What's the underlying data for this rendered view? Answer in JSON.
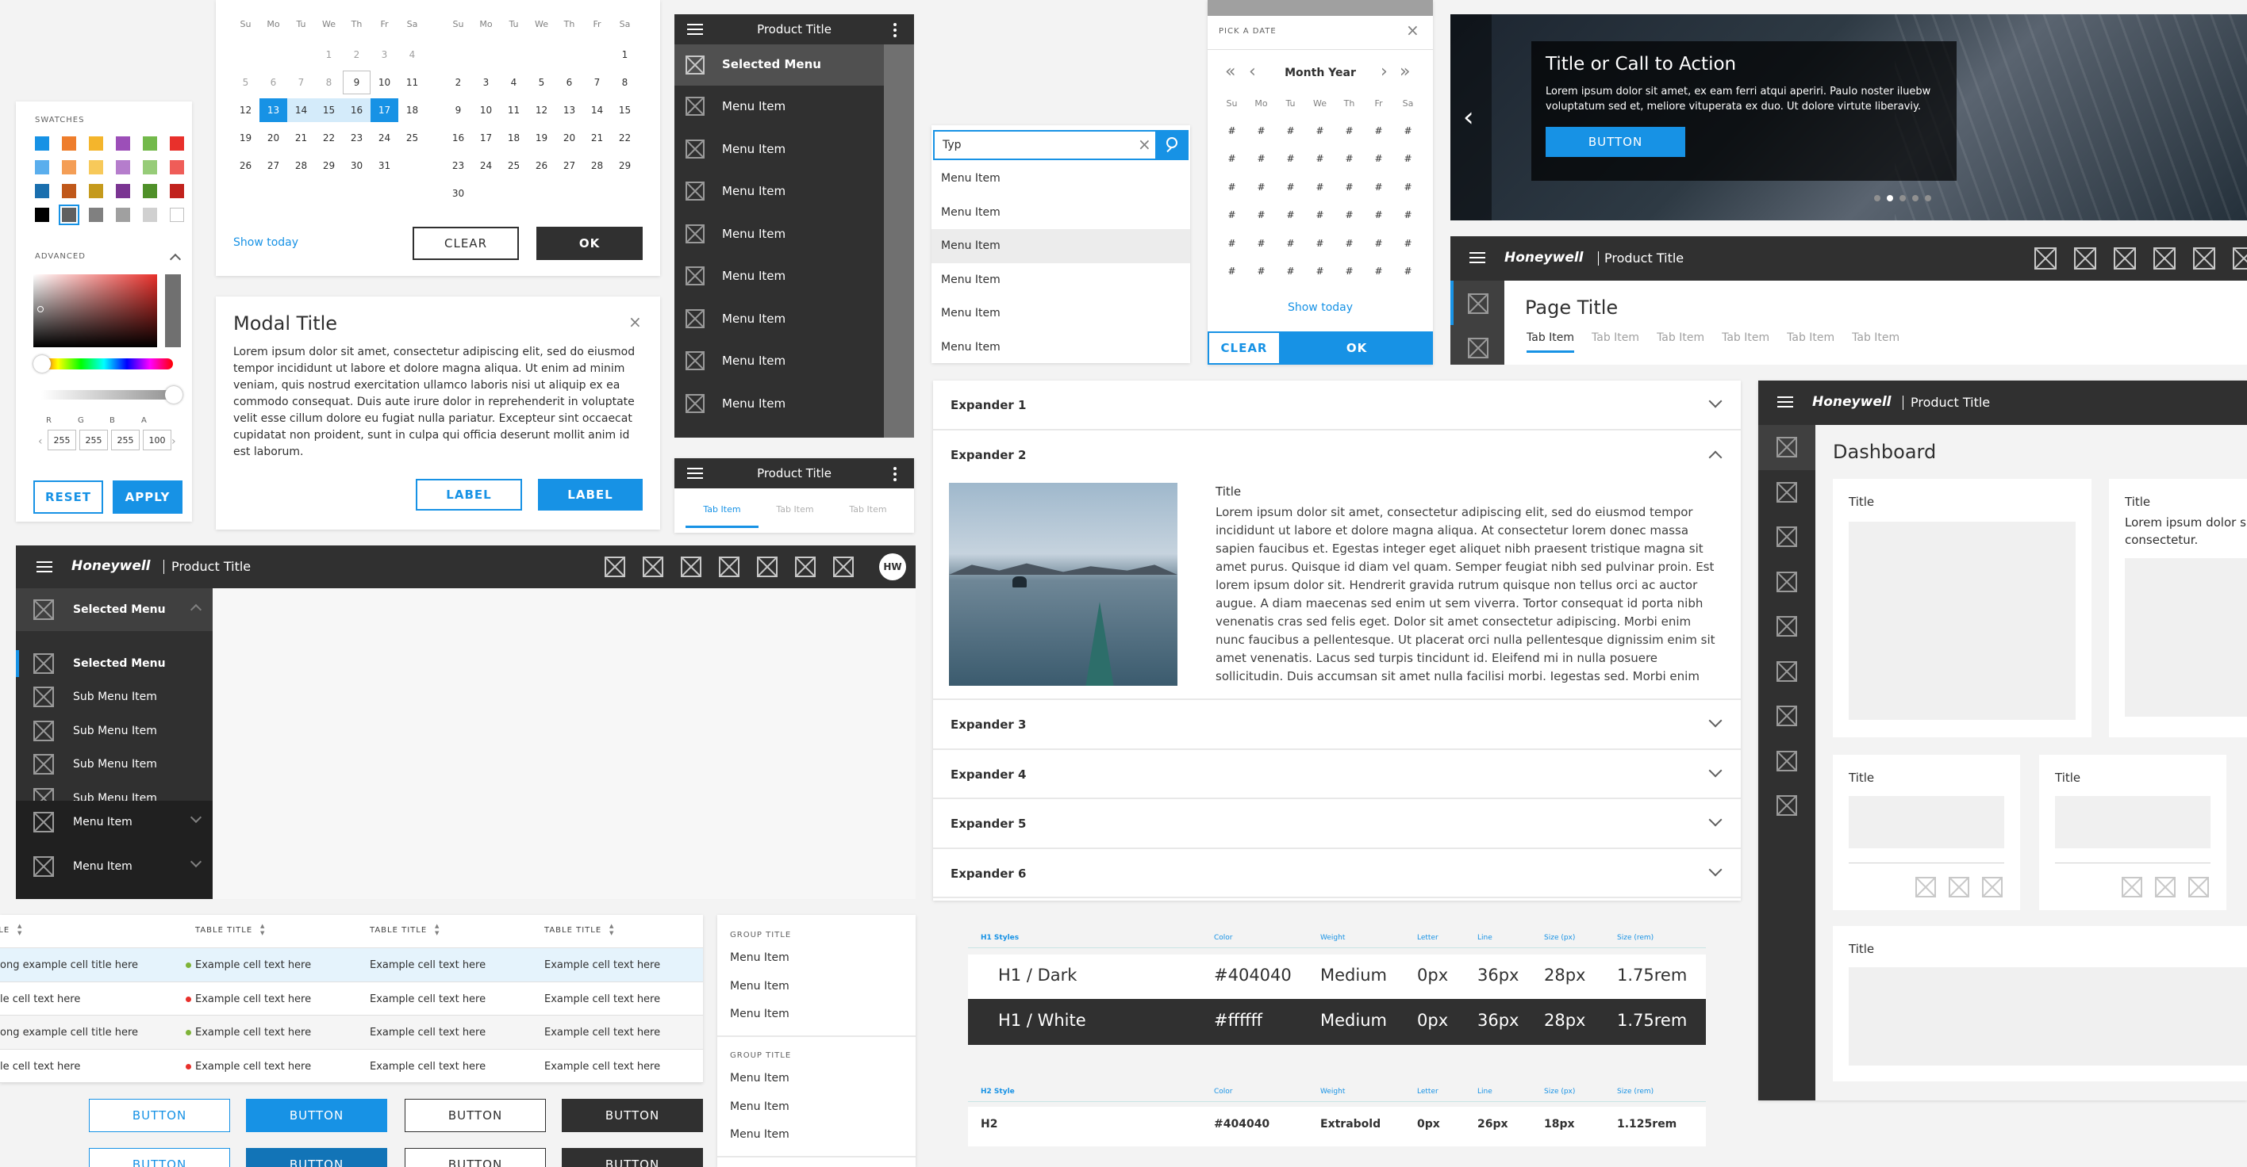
{
  "calendar_range": {
    "weekdays": [
      "Su",
      "Mo",
      "Tu",
      "We",
      "Th",
      "Fr",
      "Sa"
    ],
    "left_rows": [
      [
        "",
        "",
        "",
        "1",
        "2",
        "3",
        "4"
      ],
      [
        "5",
        "6",
        "7",
        "8",
        "9",
        "10",
        "11"
      ],
      [
        "12",
        "13",
        "14",
        "15",
        "16",
        "17",
        "18"
      ],
      [
        "19",
        "20",
        "21",
        "22",
        "23",
        "24",
        "25"
      ],
      [
        "26",
        "27",
        "28",
        "29",
        "30",
        "31",
        ""
      ]
    ],
    "right_rows": [
      [
        "",
        "",
        "",
        "",
        "",
        "",
        "1"
      ],
      [
        "2",
        "3",
        "4",
        "5",
        "6",
        "7",
        "8"
      ],
      [
        "9",
        "10",
        "11",
        "12",
        "13",
        "14",
        "15"
      ],
      [
        "16",
        "17",
        "18",
        "19",
        "20",
        "21",
        "22"
      ],
      [
        "23",
        "24",
        "25",
        "26",
        "27",
        "28",
        "29"
      ],
      [
        "30",
        "",
        "",
        "",
        "",
        "",
        ""
      ]
    ],
    "show_today": "Show today",
    "clear": "CLEAR",
    "ok": "OK"
  },
  "swatches": {
    "title": "SWATCHES",
    "advanced": "ADVANCED",
    "colors": [
      "#1792e5",
      "#ee7d2c",
      "#f4b52c",
      "#9c4fb8",
      "#73b94b",
      "#e8302b",
      "#5aaeed",
      "#f49e56",
      "#f7c95a",
      "#b57dcc",
      "#97cc78",
      "#ef5d58",
      "#1a6fae",
      "#c0581a",
      "#c59a1c",
      "#7a3592",
      "#4f9029",
      "#c1221d",
      "#000000",
      "#606060",
      "#808080",
      "#a0a0a0",
      "#d0d0d0",
      "#ffffff"
    ],
    "rgba_labels": [
      "R",
      "G",
      "B",
      "A"
    ],
    "rgba_values": [
      "255",
      "255",
      "255",
      "100"
    ],
    "reset": "RESET",
    "apply": "APPLY"
  },
  "modal": {
    "title": "Modal Title",
    "body": "Lorem ipsum dolor sit amet, consectetur adipiscing elit, sed do eiusmod tempor incididunt ut labore et dolore magna aliqua. Ut enim ad minim veniam, quis nostrud exercitation ullamco laboris nisi ut aliquip ex ea commodo consequat. Duis aute irure dolor in reprehenderit in voluptate velit esse cillum dolore eu fugiat nulla pariatur. Excepteur sint occaecat cupidatat non proident, sunt in culpa qui officia deserunt mollit anim id est laborum.",
    "label1": "LABEL",
    "label2": "LABEL"
  },
  "mobile_nav": {
    "title": "Product Title",
    "selected": "Selected Menu",
    "items": [
      "Menu Item",
      "Menu Item",
      "Menu Item",
      "Menu Item",
      "Menu Item",
      "Menu Item",
      "Menu Item",
      "Menu Item"
    ]
  },
  "mobile_tabs": {
    "title": "Product Title",
    "tabs": [
      "Tab Item",
      "Tab Item",
      "Tab Item"
    ]
  },
  "search": {
    "value": "Typ",
    "items": [
      "Menu Item",
      "Menu Item",
      "Menu Item",
      "Menu Item",
      "Menu Item",
      "Menu Item"
    ]
  },
  "datepicker": {
    "header": "PICK A DATE",
    "month_year": "Month Year",
    "weekdays": [
      "Su",
      "Mo",
      "Tu",
      "We",
      "Th",
      "Fr",
      "Sa"
    ],
    "cell": "#",
    "show_today": "Show today",
    "clear": "CLEAR",
    "ok": "OK"
  },
  "hero": {
    "title": "Title or Call to Action",
    "body": "Lorem ipsum dolor sit amet, ex eam ferri atqui aperiri. Paulo noster iluebw voluptatum sed et, meliore vituperata ex duo. Ut dolore virtute liberaviy.",
    "button": "BUTTON"
  },
  "header_main": {
    "brand": "Honeywell",
    "product": "Product Title",
    "page_title": "Page Title",
    "tabs": [
      "Tab Item",
      "Tab Item",
      "Tab Item",
      "Tab Item",
      "Tab Item",
      "Tab Item"
    ]
  },
  "desktop_nav": {
    "brand": "Honeywell",
    "product": "Product Title",
    "avatar": "HW",
    "selected_top": "Selected Menu",
    "selected_sub": "Selected Menu",
    "sub_items": [
      "Sub Menu Item",
      "Sub Menu Item",
      "Sub Menu Item",
      "Sub Menu Item"
    ],
    "items": [
      "Menu Item",
      "Menu Item"
    ]
  },
  "expanders": {
    "items": [
      "Expander 1",
      "Expander 2",
      "Expander 3",
      "Expander 4",
      "Expander 5",
      "Expander 6"
    ],
    "content_title": "Title",
    "content_body": "Lorem ipsum dolor sit amet, consectetur adipiscing elit, sed do eiusmod tempor incididunt ut labore et dolore magna aliqua. At consectetur lorem donec massa sapien faucibus et. Egestas integer eget aliquet nibh praesent tristique magna sit amet purus. Quisque id diam vel quam. Semper feugiat nibh sed pulvinar proin. Est lorem ipsum dolor sit. Hendrerit gravida rutrum quisque non tellus orci ac auctor augue. A diam maecenas sed enim ut sem viverra. Tortor consequat id porta nibh venenatis cras sed felis eget. Dolor sit amet consectetur adipiscing. Morbi enim nunc faucibus a pellentesque. Ut placerat orci nulla pellentesque dignissim enim sit amet venenatis. Lacus sed turpis tincidunt id. Eleifend mi in nulla posuere sollicitudin. Duis accumsan sit amet nulla facilisi morbi. Iegestas sed. Morbi enim"
  },
  "dashboard": {
    "brand": "Honeywell",
    "product": "Product Title",
    "title": "Dashboard",
    "card_title": "Title",
    "card_text": "Lorem ipsum dolor s consectetur."
  },
  "table": {
    "headers": [
      "TABLE TITLE",
      "TABLE TITLE",
      "TABLE TITLE",
      "TABLE TITLE"
    ],
    "rows": [
      [
        "ong example cell title here",
        "Example cell text here",
        "Example cell text here",
        "Example cell text here"
      ],
      [
        "le cell text here",
        "Example cell text here",
        "Example cell text here",
        "Example cell text here"
      ],
      [
        "ong example cell title here",
        "Example cell text here",
        "Example cell text here",
        "Example cell text here"
      ],
      [
        "le cell text here",
        "Example cell text here",
        "Example cell text here",
        "Example cell text here"
      ]
    ],
    "dots": [
      "#7eb338",
      "#e8302b",
      "#7eb338",
      "#e8302b"
    ]
  },
  "buttons": {
    "label": "BUTTON"
  },
  "group_list": {
    "title1": "GROUP TITLE",
    "items1": [
      "Menu Item",
      "Menu Item",
      "Menu Item"
    ],
    "title2": "GROUP TITLE",
    "items2": [
      "Menu Item",
      "Menu Item",
      "Menu Item"
    ]
  },
  "typography": {
    "h1_headers": [
      "H1 Styles",
      "Color",
      "Weight",
      "Letter",
      "Line",
      "Size (px)",
      "Size (rem)"
    ],
    "h1_dark": [
      "H1 / Dark",
      "#404040",
      "Medium",
      "0px",
      "36px",
      "28px",
      "1.75rem"
    ],
    "h1_white": [
      "H1 / White",
      "#ffffff",
      "Medium",
      "0px",
      "36px",
      "28px",
      "1.75rem"
    ],
    "h2_headers": [
      "H2 Style",
      "Color",
      "Weight",
      "Letter",
      "Line",
      "Size (px)",
      "Size (rem)"
    ],
    "h2_row": [
      "H2",
      "#404040",
      "Extrabold",
      "0px",
      "26px",
      "18px",
      "1.125rem"
    ]
  }
}
